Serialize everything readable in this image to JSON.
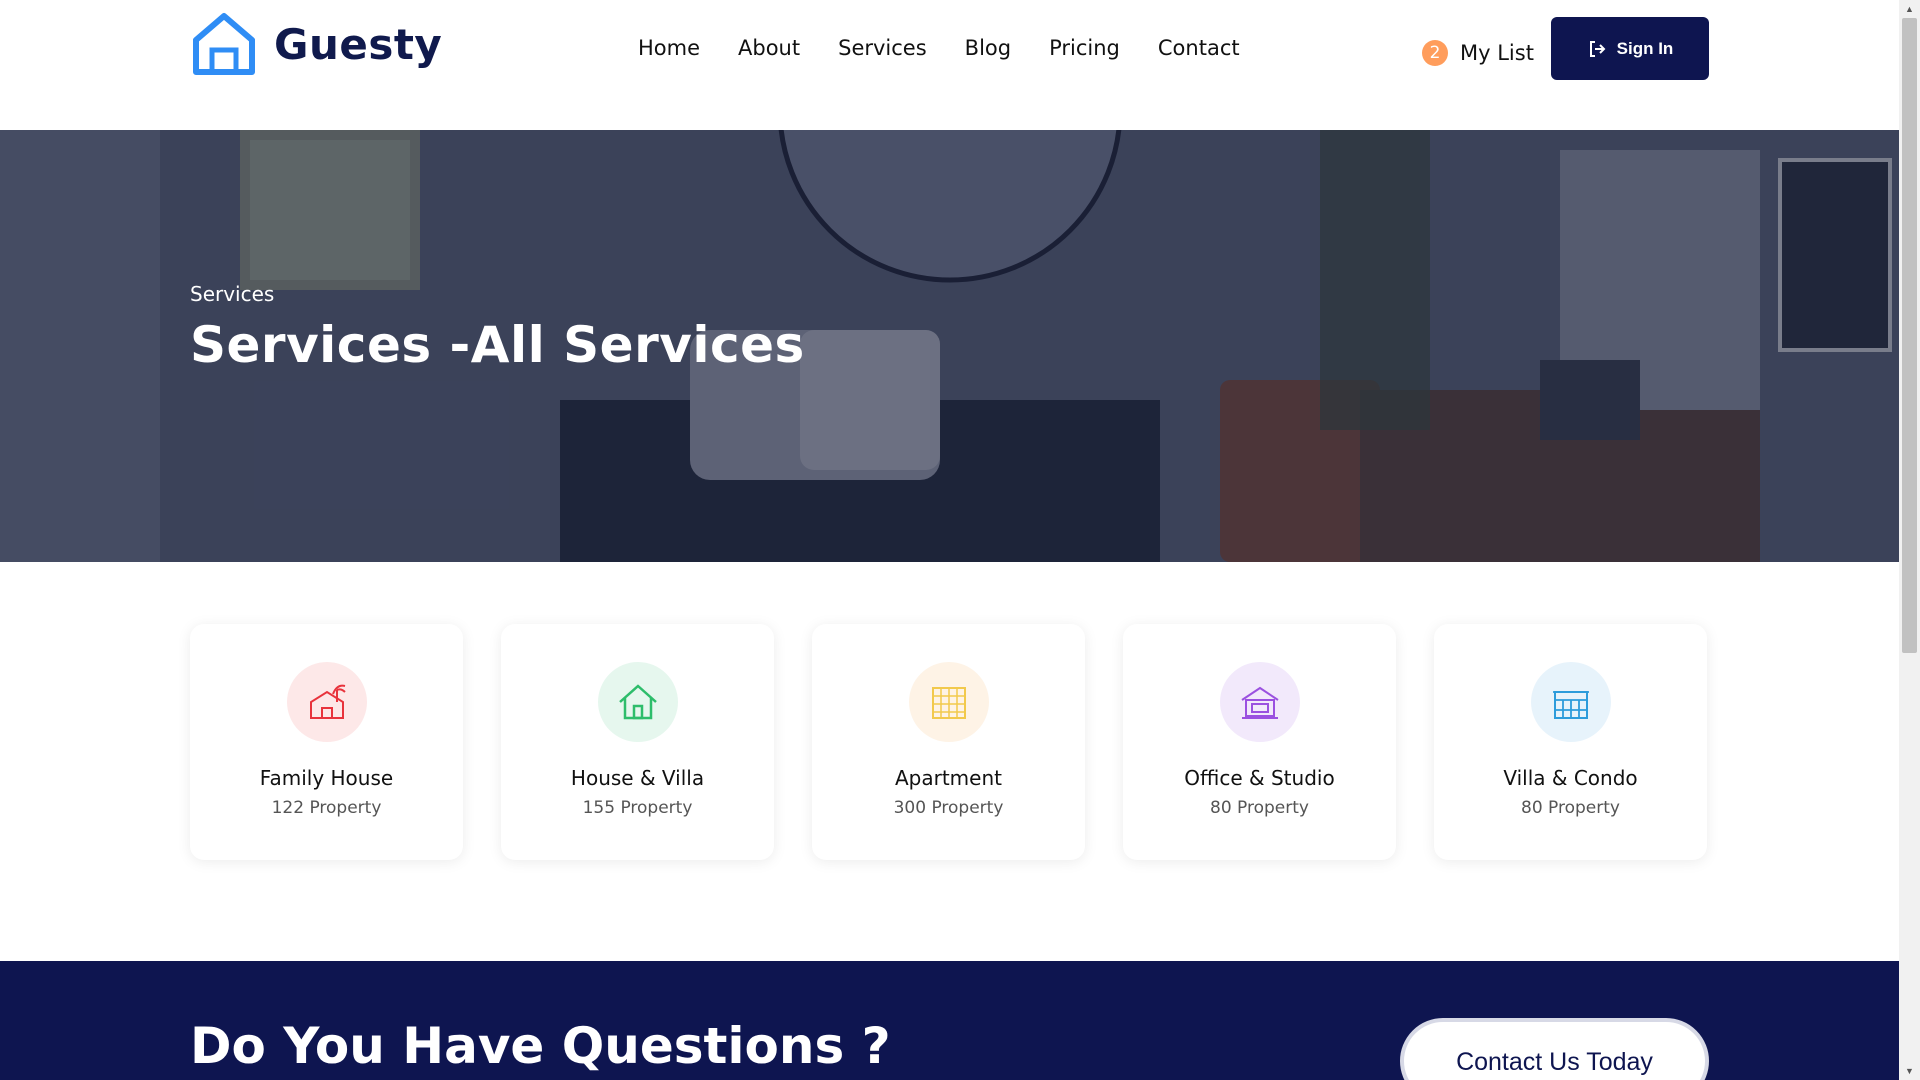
{
  "header": {
    "logo_text": "Guesty",
    "nav": [
      "Home",
      "About",
      "Services",
      "Blog",
      "Pricing",
      "Contact"
    ],
    "mylist_count": "2",
    "mylist_label": "My List",
    "signin_label": "Sign In"
  },
  "hero": {
    "subtitle": "Services",
    "title": "Services -All Services"
  },
  "cards": [
    {
      "title": "Family House",
      "count": "122 Property",
      "icon": "family-house-icon",
      "color": "#e8333c",
      "bg": "#fde8e8"
    },
    {
      "title": "House & Villa",
      "count": "155 Property",
      "icon": "house-villa-icon",
      "color": "#2ebd6b",
      "bg": "#e6f7ee"
    },
    {
      "title": "Apartment",
      "count": "300 Property",
      "icon": "apartment-icon",
      "color": "#f2c94c",
      "bg": "#fef3e6"
    },
    {
      "title": "Office & Studio",
      "count": "80 Property",
      "icon": "office-studio-icon",
      "color": "#9b51e0",
      "bg": "#f2e9fb"
    },
    {
      "title": "Villa & Condo",
      "count": "80 Property",
      "icon": "villa-condo-icon",
      "color": "#2d9cdb",
      "bg": "#e7f3fb"
    }
  ],
  "cta": {
    "title": "Do You Have Questions ?",
    "button_label": "Contact Us Today"
  },
  "colors": {
    "navy": "#0e1550",
    "logo_blue": "#2f8df5",
    "badge_orange": "#ff9d5c"
  }
}
